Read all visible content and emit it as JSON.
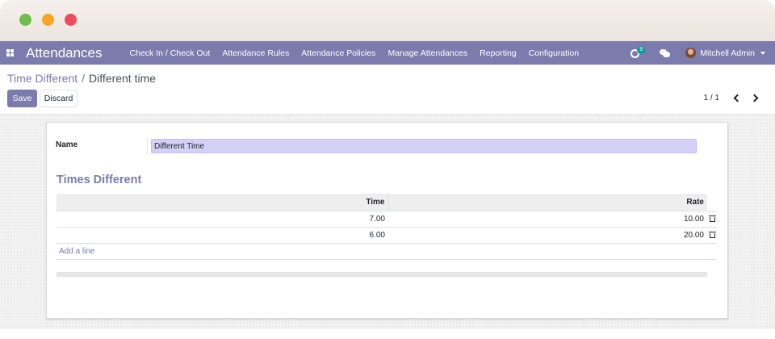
{
  "navbar": {
    "app_name": "Attendances",
    "menu": [
      "Check In / Check Out",
      "Attendance Rules",
      "Attendance Policies",
      "Manage Attendances",
      "Reporting",
      "Configuration"
    ],
    "activity_count": "9",
    "user_name": "Mitchell Admin"
  },
  "breadcrumb": {
    "parent": "Time Different",
    "separator": "/",
    "current": "Different time"
  },
  "buttons": {
    "save": "Save",
    "discard": "Discard"
  },
  "pager": {
    "value": "1 / 1"
  },
  "form": {
    "name_label": "Name",
    "name_value": "Different Time",
    "section_title": "Times Different",
    "columns": {
      "time": "Time",
      "rate": "Rate"
    },
    "rows": [
      {
        "time": "7.00",
        "rate": "10.00"
      },
      {
        "time": "6.00",
        "rate": "20.00"
      }
    ],
    "add_line": "Add a line"
  },
  "colors": {
    "brand": "#7c7bad",
    "input_bg": "#d4d0f7",
    "badge": "#00a09d"
  }
}
